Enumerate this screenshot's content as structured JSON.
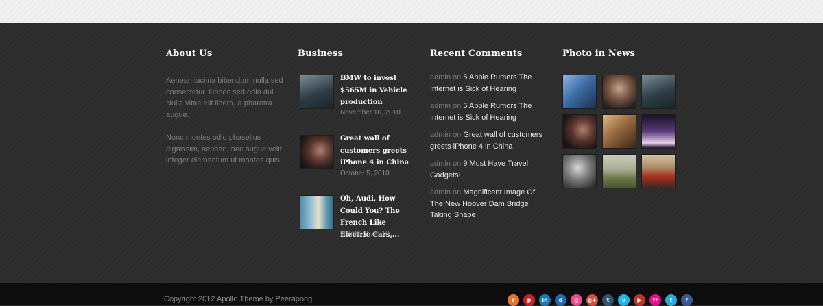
{
  "about": {
    "heading": "About Us",
    "paragraph_1": "Aenean lacinia bibendum nulla sed consectetur. Donec sed odio dui. Nulla vitae elit libero, a pharetra augue.",
    "paragraph_2": "Nunc montes odio phasellus dignissim, aenean, nec augue velit integer elementum ut montes quis"
  },
  "business": {
    "heading": "Business",
    "items": [
      {
        "title": "BMW to invest $565M in Vehicle production",
        "date": "November 10, 2010",
        "thumb": "man-in-coat-photo"
      },
      {
        "title": "Great wall of customers greets iPhone 4 in China",
        "date": "October 5, 2010",
        "thumb": "woman-portrait-photo"
      },
      {
        "title": "Oh, Audi, How Could You? The French Like Electric Cars,...",
        "date": "October 5, 2010",
        "thumb": "city-street-photo"
      }
    ]
  },
  "comments": {
    "heading": "Recent Comments",
    "items": [
      {
        "author": "admin",
        "on": "on",
        "link": "5 Apple Rumors The Internet is Sick of Hearing"
      },
      {
        "author": "admin",
        "on": "on",
        "link": "5 Apple Rumors The Internet is Sick of Hearing"
      },
      {
        "author": "admin",
        "on": "on",
        "link": "Great wall of customers greets iPhone 4 in China"
      },
      {
        "author": "admin",
        "on": "on",
        "link": "9 Must Have Travel Gadgets!"
      },
      {
        "author": "admin",
        "on": "on",
        "link": "Magnificent Image Of The New Hoover Dam Bridge Taking Shape"
      }
    ]
  },
  "photos": {
    "heading": "Photo in News",
    "items": [
      {
        "name": "city-night-photo",
        "color": "#3a5f8a"
      },
      {
        "name": "woman-portrait-photo",
        "color": "#6b5648"
      },
      {
        "name": "man-in-coat-photo",
        "color": "#55656e"
      },
      {
        "name": "woman-dark-hair-photo",
        "color": "#4a3a3a"
      },
      {
        "name": "restaurant-photo",
        "color": "#7a5a3a"
      },
      {
        "name": "concert-photo",
        "color": "#3a2a4a"
      },
      {
        "name": "woman-bw-photo",
        "color": "#777777"
      },
      {
        "name": "countryside-tree-photo",
        "color": "#6f7a5a"
      },
      {
        "name": "london-bus-photo",
        "color": "#7a4a3a"
      }
    ]
  },
  "bottom": {
    "copyright": "Copyright 2012 Apollo Theme by Peerapong",
    "social": [
      {
        "name": "rss-icon",
        "glyph": "r",
        "color": "#e9722d"
      },
      {
        "name": "pinterest-icon",
        "glyph": "p",
        "color": "#cb2027"
      },
      {
        "name": "linkedin-icon",
        "glyph": "in",
        "color": "#1d7bb4"
      },
      {
        "name": "digg-icon",
        "glyph": "d",
        "color": "#1f6bb0"
      },
      {
        "name": "dribbble-icon",
        "glyph": "◎",
        "color": "#ea4c89"
      },
      {
        "name": "googleplus-icon",
        "glyph": "g+",
        "color": "#dd4b39"
      },
      {
        "name": "tumblr-icon",
        "glyph": "t",
        "color": "#35506f"
      },
      {
        "name": "vimeo-icon",
        "glyph": "v",
        "color": "#1ab7ea"
      },
      {
        "name": "youtube-icon",
        "glyph": "▶",
        "color": "#c4302b"
      },
      {
        "name": "flickr-icon",
        "glyph": "fr",
        "color": "#e60d8c"
      },
      {
        "name": "twitter-icon",
        "glyph": "t",
        "color": "#2aa9e0"
      },
      {
        "name": "facebook-icon",
        "glyph": "f",
        "color": "#3b5998"
      }
    ]
  }
}
